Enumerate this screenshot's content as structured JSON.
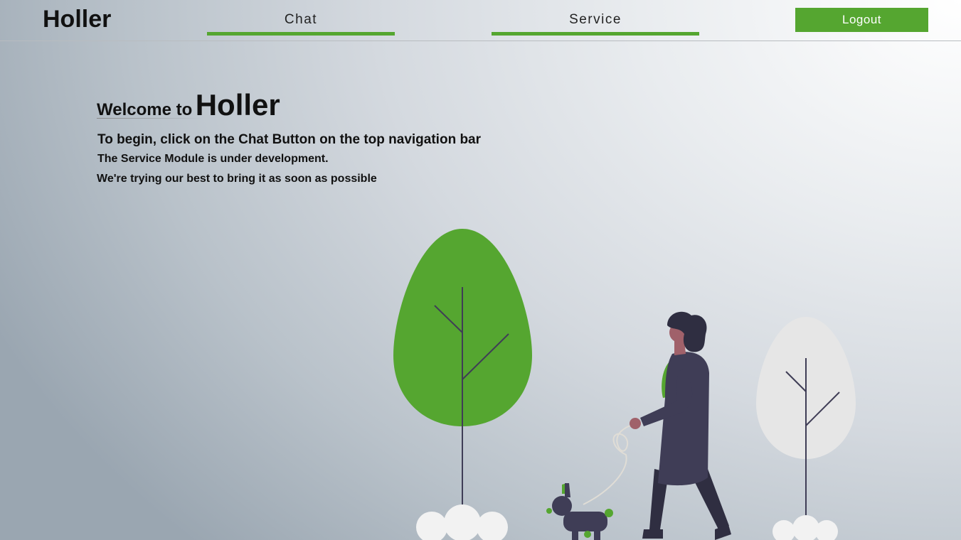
{
  "nav": {
    "brand": "Holler",
    "links": [
      "Chat",
      "Service"
    ],
    "logout_label": "Logout",
    "accent_color": "#55a630"
  },
  "main": {
    "welcome_prefix": "Welcome to",
    "welcome_name": "Holler",
    "instruction": "To begin, click on the Chat Button on the top navigation bar",
    "notice_1": "The Service Module is under development.",
    "notice_2": "We're trying our best to bring it as soon as possible"
  },
  "illustration": {
    "subject": "woman-walking-dog",
    "tree_colors": [
      "#55a630",
      "#e6e6e6"
    ],
    "figure_color": "#3f3d56"
  }
}
